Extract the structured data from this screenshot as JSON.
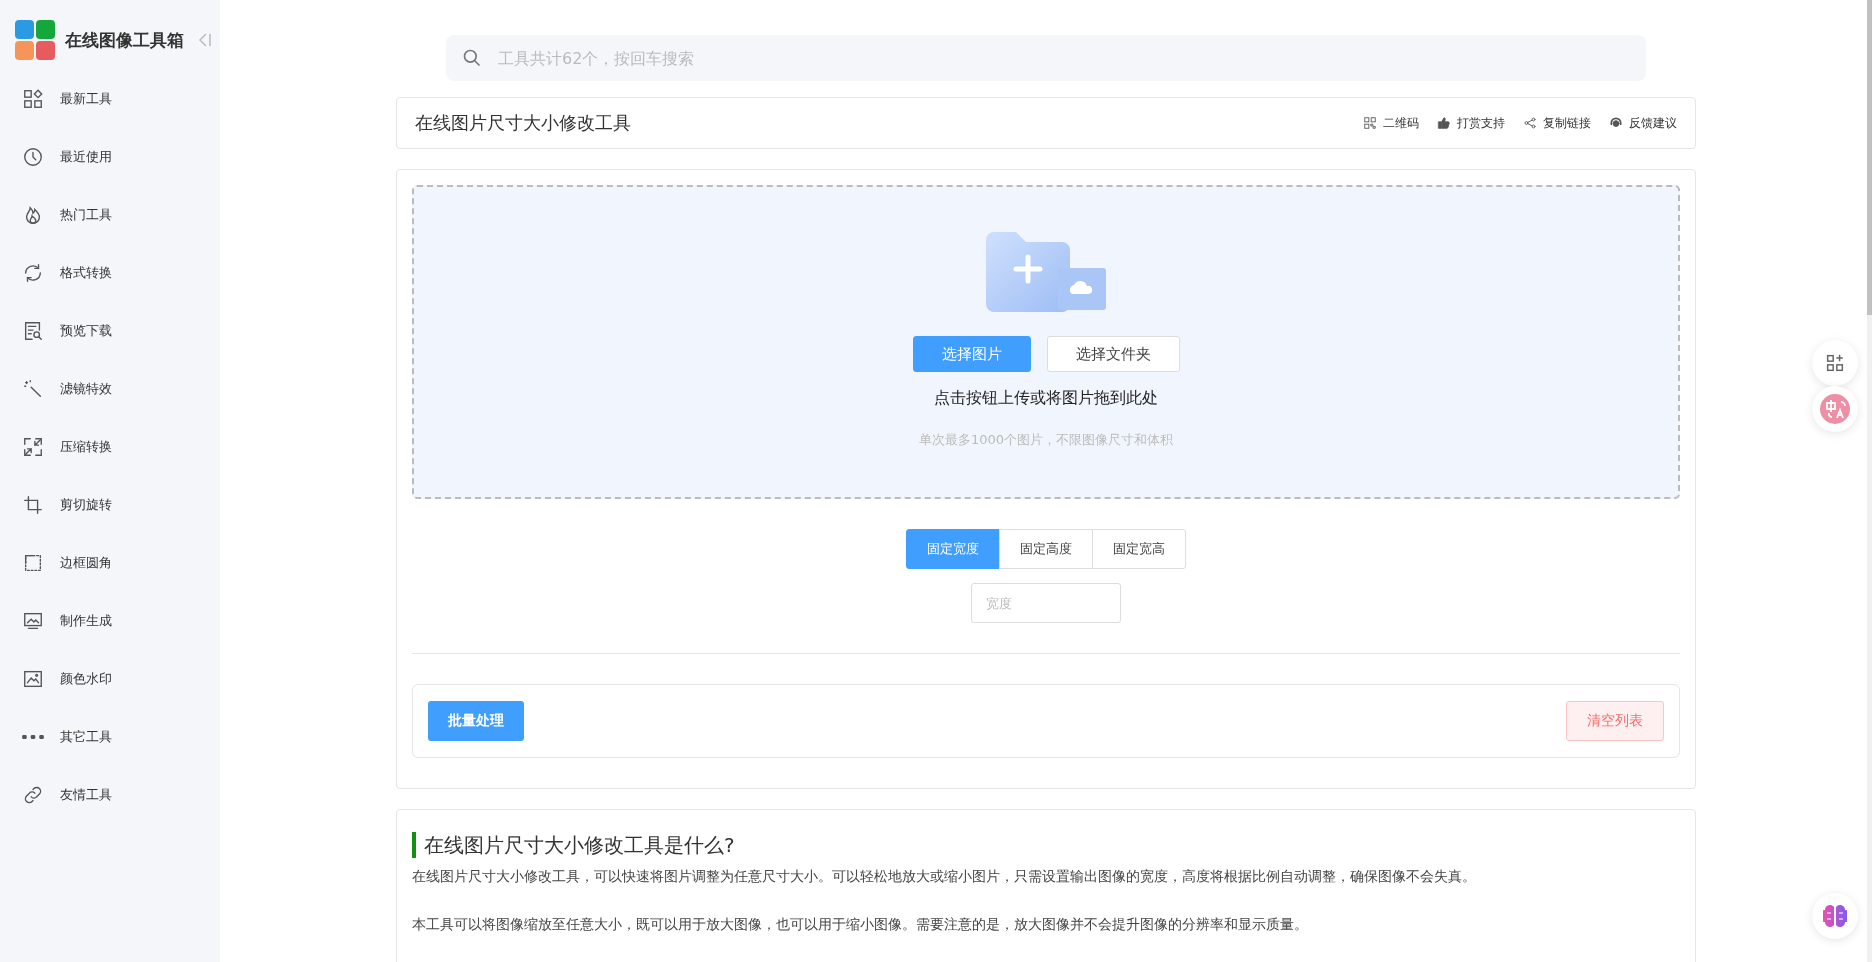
{
  "sidebar": {
    "title": "在线图像工具箱",
    "items": [
      {
        "label": "最新工具"
      },
      {
        "label": "最近使用"
      },
      {
        "label": "热门工具"
      },
      {
        "label": "格式转换"
      },
      {
        "label": "预览下载"
      },
      {
        "label": "滤镜特效"
      },
      {
        "label": "压缩转换"
      },
      {
        "label": "剪切旋转"
      },
      {
        "label": "边框圆角"
      },
      {
        "label": "制作生成"
      },
      {
        "label": "颜色水印"
      },
      {
        "label": "其它工具"
      },
      {
        "label": "友情工具"
      }
    ]
  },
  "search": {
    "placeholder": "工具共计62个，按回车搜索"
  },
  "tool_header": {
    "title": "在线图片尺寸大小修改工具",
    "actions": [
      "二维码",
      "打赏支持",
      "复制链接",
      "反馈建议"
    ]
  },
  "upload": {
    "buttons": [
      "选择图片",
      "选择文件夹"
    ],
    "hint": "点击按钮上传或将图片拖到此处",
    "note": "单次最多1000个图片，不限图像尺寸和体积"
  },
  "modes": [
    {
      "label": "固定宽度",
      "selected": true
    },
    {
      "label": "固定高度",
      "selected": false
    },
    {
      "label": "固定宽高",
      "selected": false
    }
  ],
  "size_input": {
    "placeholder": "宽度"
  },
  "batch": {
    "process": "批量处理",
    "clear": "清空列表"
  },
  "about": {
    "heading": "在线图片尺寸大小修改工具是什么?",
    "paragraphs": [
      "在线图片尺寸大小修改工具，可以快速将图片调整为任意尺寸大小。可以轻松地放大或缩小图片，只需设置输出图像的宽度，高度将根据比例自动调整，确保图像不会失真。",
      "本工具可以将图像缩放至任意大小，既可以用于放大图像，也可以用于缩小图像。需要注意的是，放大图像并不会提升图像的分辨率和显示质量。"
    ]
  }
}
